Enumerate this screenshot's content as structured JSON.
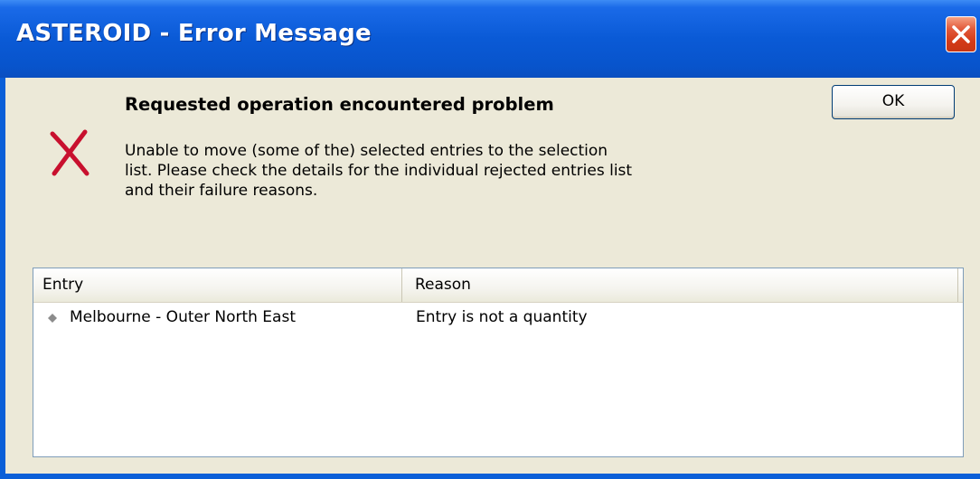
{
  "window": {
    "title": "ASTEROID - Error Message"
  },
  "dialog": {
    "heading": "Requested operation encountered problem",
    "message_lines": [
      "Unable to move (some of the) selected entries to the selection",
      "list. Please check the details for the individual rejected entries list",
      "and their failure reasons."
    ],
    "ok_label": "OK",
    "icon": "error-x-icon"
  },
  "table": {
    "columns": [
      "Entry",
      "Reason"
    ],
    "rows": [
      {
        "entry": "Melbourne - Outer North East",
        "reason": "Entry is not a quantity"
      }
    ]
  },
  "colors": {
    "titlebar": "#0a5ad6",
    "client_background": "#ece9d8",
    "close_button": "#d33b18",
    "error_icon": "#c8102e"
  }
}
